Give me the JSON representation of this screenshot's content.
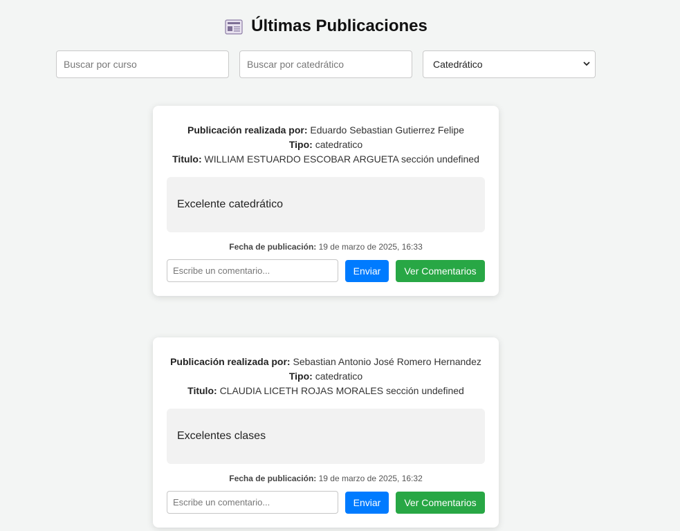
{
  "header": {
    "icon": "newspaper-icon",
    "title": "Últimas Publicaciones"
  },
  "filters": {
    "course_placeholder": "Buscar por curso",
    "professor_placeholder": "Buscar por catedrático",
    "type_selected": "Catedrático"
  },
  "labels": {
    "author": "Publicación realizada por:",
    "type": "Tipo:",
    "title": "Titulo:",
    "date": "Fecha de publicación:",
    "comment_placeholder": "Escribe un comentario...",
    "send": "Enviar",
    "view_comments": "Ver Comentarios"
  },
  "posts": [
    {
      "author": "Eduardo Sebastian Gutierrez Felipe",
      "type": "catedratico",
      "title": "WILLIAM ESTUARDO ESCOBAR ARGUETA sección undefined",
      "content": "Excelente catedrático",
      "date": "19 de marzo de 2025, 16:33"
    },
    {
      "author": "Sebastian Antonio José Romero Hernandez",
      "type": "catedratico",
      "title": "CLAUDIA LICETH ROJAS MORALES sección undefined",
      "content": "Excelentes clases",
      "date": "19 de marzo de 2025, 16:32"
    }
  ],
  "colors": {
    "background": "#f3f5f4",
    "send_button": "#007bff",
    "view_button": "#28a745",
    "content_box": "#f2f2f2"
  }
}
